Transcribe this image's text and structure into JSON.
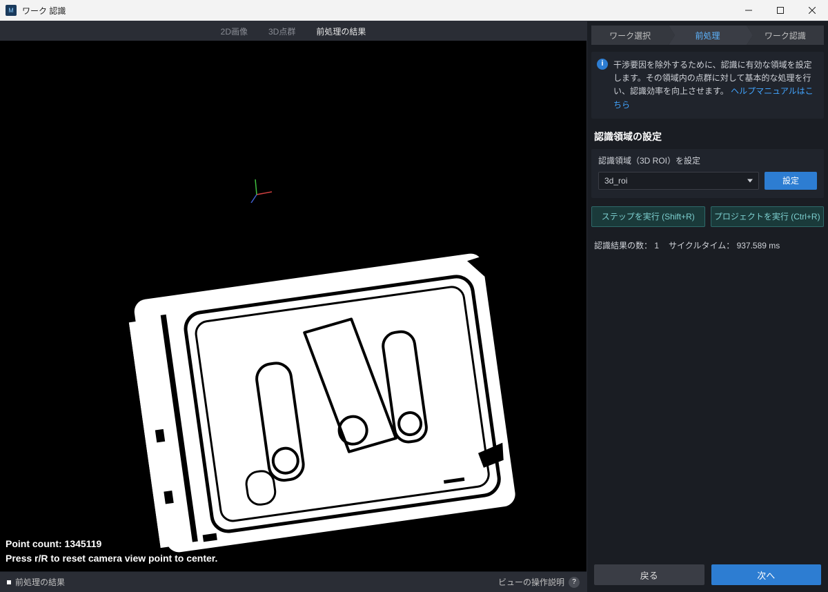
{
  "titlebar": {
    "title": "ワーク 認識"
  },
  "view_tabs": {
    "t0": "2D画像",
    "t1": "3D点群",
    "t2": "前処理の結果"
  },
  "viewport": {
    "point_count_label": "Point count:",
    "point_count_value": "1345119",
    "reset_hint": "Press r/R to reset camera view point to center."
  },
  "status": {
    "left": "前処理の結果",
    "right": "ビューの操作説明"
  },
  "steps": {
    "s0": "ワーク選択",
    "s1": "前処理",
    "s2": "ワーク認識"
  },
  "info": {
    "text": "干渉要因を除外するために、認識に有効な領域を設定します。その領域内の点群に対して基本的な処理を行い、認識効率を向上させます。",
    "link": "ヘルプマニュアルはこちら"
  },
  "section": {
    "title": "認識領域の設定"
  },
  "roi": {
    "label": "認識領域（3D ROI）を設定",
    "select_value": "3d_roi",
    "set_btn": "設定"
  },
  "run": {
    "step": "ステップを実行 (Shift+R)",
    "project": "プロジェクトを実行 (Ctrl+R)"
  },
  "result": {
    "count_label": "認識結果の数：",
    "count_value": "1",
    "cycle_label": "サイクルタイム：",
    "cycle_value": "937.589 ms"
  },
  "nav": {
    "back": "戻る",
    "next": "次へ"
  }
}
